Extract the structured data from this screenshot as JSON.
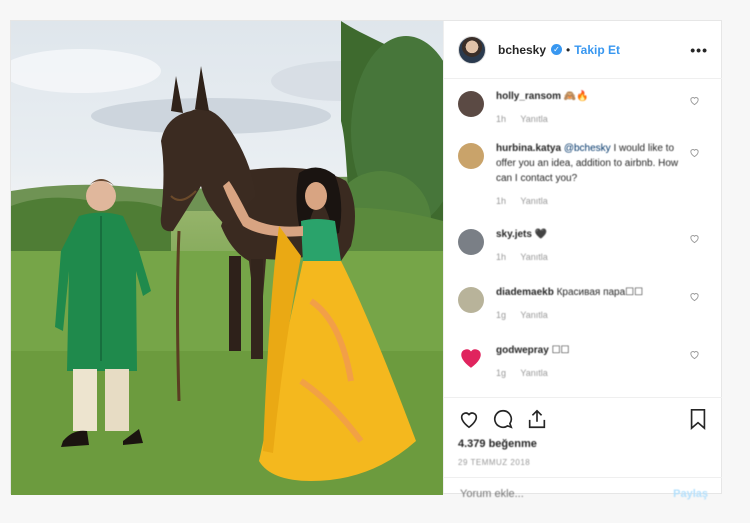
{
  "post": {
    "username": "bchesky",
    "follow_label": "Takip Et",
    "more_icon": "more-dots-icon"
  },
  "comments": [
    {
      "user": "holly_ransom",
      "text": "🙈🔥",
      "time": "1h",
      "reply": "Yanıtla",
      "avatar_color": "#5b4a44"
    },
    {
      "user": "hurbina.katya",
      "mention": "@bchesky",
      "text": "I would like to offer you an idea, addition to airbnb. How can I contact you?",
      "time": "1h",
      "reply": "Yanıtla",
      "avatar_color": "#c9a36a"
    },
    {
      "user": "sky.jets",
      "text": "🖤",
      "time": "1h",
      "reply": "Yanıtla",
      "avatar_color": "#7a7f86"
    },
    {
      "user": "diademaekb",
      "text": "Красивая пара☐☐",
      "time": "1g",
      "reply": "Yanıtla",
      "avatar_color": "#b8b39a"
    },
    {
      "user": "godwepray",
      "text": "☐☐",
      "time": "1g",
      "reply": "Yanıtla",
      "avatar_color": "#e0245e"
    }
  ],
  "stats": {
    "likes": "4.379 beğenme",
    "date": "29 TEMMUZ 2018"
  },
  "composer": {
    "placeholder": "Yorum ekle...",
    "post_label": "Paylaş"
  }
}
